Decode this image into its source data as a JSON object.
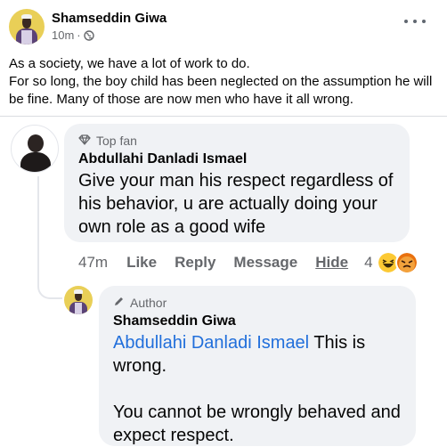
{
  "post": {
    "author": "Shamseddin Giwa",
    "time": "10m",
    "separator": "·",
    "text_line1": "As a society, we have a lot of work to do.",
    "text_line2": "For so long, the boy child has been neglected on the assumption he will be fine. Many of those are now men who have it all wrong."
  },
  "comment": {
    "badge": "Top fan",
    "author": "Abdullahi Danladi Ismael",
    "text": "Give your man his respect regardless of his behavior, u are actually doing your own role as a good wife",
    "time": "47m",
    "like": "Like",
    "reply": "Reply",
    "message": "Message",
    "hide": "Hide",
    "reaction_count": "4",
    "reactions": [
      "haha-emoji",
      "angry-emoji"
    ]
  },
  "reply": {
    "badge": "Author",
    "author": "Shamseddin Giwa",
    "mention": "Abdullahi Danladi Ismael",
    "text_after_mention": " This is wrong.",
    "text_second": "You cannot be wrongly behaved and expect respect."
  },
  "colors": {
    "meta_gray": "#65676b",
    "bubble_bg": "#f0f2f5",
    "mention_blue": "#216fdb",
    "divider": "#dadde1"
  }
}
